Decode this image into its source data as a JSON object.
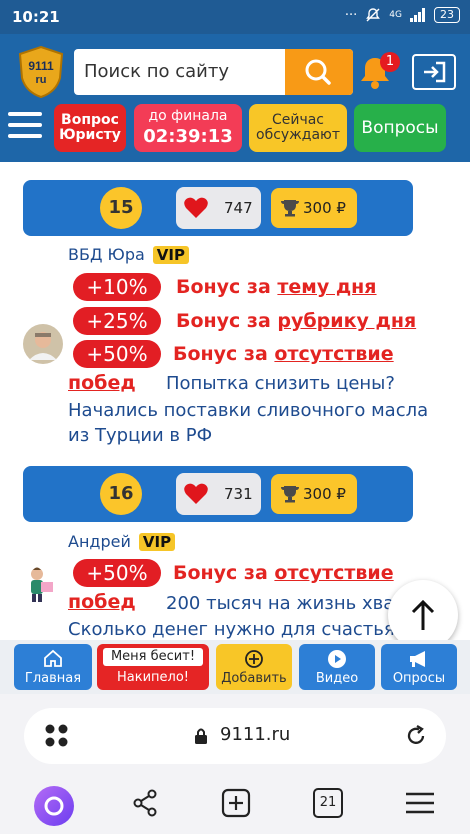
{
  "status": {
    "time": "10:21",
    "network": "4G",
    "battery": "23"
  },
  "header": {
    "logo_text": "9111 ru",
    "search_placeholder": "Поиск по сайту",
    "notifications_count": "1",
    "buttons": {
      "lawyer": "Вопрос Юристу",
      "timer_label": "до финала",
      "timer_value": "02:39:13",
      "discussing": "Сейчас обсуждают",
      "questions": "Вопросы"
    }
  },
  "posts": [
    {
      "rank": "15",
      "likes": "747",
      "prize": "300 ₽",
      "author": "ВБД Юра",
      "vip": "VIP",
      "bonuses": [
        {
          "pct": "+10%",
          "text": "Бонус за ",
          "link": "тему дня"
        },
        {
          "pct": "+25%",
          "text": "Бонус за ",
          "link": "рубрику дня"
        },
        {
          "pct": "+50%",
          "text": "Бонус за ",
          "link": "отсутствие",
          "link2": "побед"
        }
      ],
      "teaser": "Попытка снизить цены?",
      "title_line1": "Начались поставки сливочного масла",
      "title_line2": "из Турции в РФ"
    },
    {
      "rank": "16",
      "likes": "731",
      "prize": "300 ₽",
      "author": "Андрей",
      "vip": "VIP",
      "bonuses": [
        {
          "pct": "+50%",
          "text": "Бонус за ",
          "link": "отсутствие",
          "link2": "побед"
        }
      ],
      "teaser": "200 тысяч на жизнь хва",
      "title_line1": "Сколько денег нужно для счастья"
    }
  ],
  "bottom_nav": {
    "home": "Главная",
    "annoyed_tag": "Меня бесит!",
    "annoyed": "Накипело!",
    "add": "Добавить",
    "video": "Видео",
    "polls": "Опросы"
  },
  "browser": {
    "url": "9111.ru",
    "tabs_count": "21"
  },
  "colors": {
    "header": "#1e66a8",
    "accent_red": "#e32421",
    "accent_yellow": "#f8c627",
    "link_blue": "#1e4b8f"
  }
}
